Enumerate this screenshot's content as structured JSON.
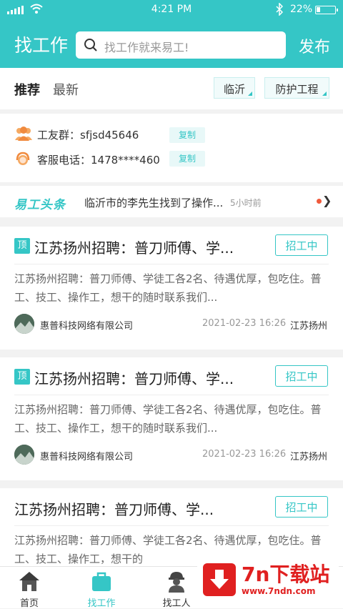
{
  "status_bar": {
    "time": "4:21 PM",
    "battery": "22%",
    "battery_level": 0.22
  },
  "header": {
    "title": "找工作",
    "search_placeholder": "找工作就来易工!",
    "publish_label": "发布"
  },
  "tabs": {
    "recommend": "推荐",
    "latest": "最新"
  },
  "filters": {
    "city": "临沂",
    "category": "防护工程"
  },
  "info": {
    "group_label": "工友群：sfjsd45646",
    "phone_label": "客服电话：1478****460",
    "copy_label": "复制"
  },
  "news": {
    "logo": "易工头条",
    "text": "临沂市的李先生找到了操作...",
    "time_ago": "5小时前"
  },
  "jobs": [
    {
      "badge": "顶",
      "title": "江苏扬州招聘：普刀师傅、学...",
      "status": "招工中",
      "description": "江苏扬州招聘：普刀师傅、学徒工各2名、待遇优厚，包吃住。普工、技工、操作工，想干的随时联系我们...",
      "company": "惠普科技网络有限公司",
      "date": "2021-02-23 16:26",
      "city": "江苏扬州"
    },
    {
      "badge": "顶",
      "title": "江苏扬州招聘：普刀师傅、学...",
      "status": "招工中",
      "description": "江苏扬州招聘：普刀师傅、学徒工各2名、待遇优厚，包吃住。普工、技工、操作工，想干的随时联系我们...",
      "company": "惠普科技网络有限公司",
      "date": "2021-02-23 16:26",
      "city": "江苏扬州"
    },
    {
      "title": "江苏扬州招聘：普刀师傅、学...",
      "status": "招工中",
      "description": "江苏扬州招聘：普刀师傅、学徒工各2名、待遇优厚，包吃住。普工、技工、操作工，想干的"
    }
  ],
  "tabbar": {
    "home": "首页",
    "find_job": "找工作",
    "find_worker": "找工人"
  },
  "watermark": {
    "title": "7n下载站",
    "url": "www.7ndn.com"
  },
  "colors": {
    "accent": "#35c6c6",
    "watermark_red": "#e02020"
  }
}
